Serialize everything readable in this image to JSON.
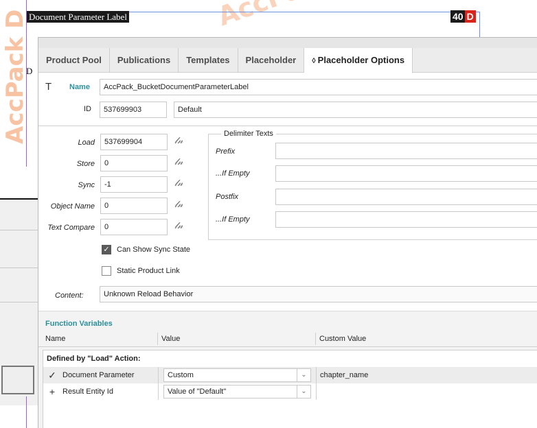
{
  "document": {
    "label": "Document Parameter Label",
    "page_number": "40",
    "page_letter": "D",
    "fragment_letter": "D",
    "watermark_text": "AccPack D",
    "watermark_top": "AccPa"
  },
  "tabs": [
    {
      "label": "Product Pool",
      "active": false
    },
    {
      "label": "Publications",
      "active": false
    },
    {
      "label": "Templates",
      "active": false
    },
    {
      "label": "Placeholder",
      "active": false
    },
    {
      "label": "Placeholder Options",
      "active": true,
      "icon": "chevron-up-down-icon",
      "icon_glyph": "◊"
    }
  ],
  "header": {
    "name_label": "Name",
    "name_value": "AccPack_BucketDocumentParameterLabel",
    "id_label": "ID",
    "id_value": "537699903",
    "id_extra": "Default"
  },
  "parameters": [
    {
      "label": "Load",
      "value": "537699904"
    },
    {
      "label": "Store",
      "value": "0"
    },
    {
      "label": "Sync",
      "value": "-1"
    },
    {
      "label": "Object Name",
      "value": "0"
    },
    {
      "label": "Text Compare",
      "value": "0"
    }
  ],
  "delimiter": {
    "title": "Delimiter Texts",
    "fields": [
      {
        "label": "Prefix",
        "value": ""
      },
      {
        "label": "...If Empty",
        "value": ""
      },
      {
        "label": "Postfix",
        "value": ""
      },
      {
        "label": "...If Empty",
        "value": ""
      }
    ]
  },
  "checkboxes": [
    {
      "label": "Can Show Sync State",
      "checked": true
    },
    {
      "label": "Static Product Link",
      "checked": false
    }
  ],
  "content": {
    "label": "Content:",
    "value": "Unknown Reload Behavior"
  },
  "function_variables": {
    "title": "Function Variables",
    "columns": [
      "Name",
      "Value",
      "Custom Value"
    ],
    "group_label": "Defined by \"Load\" Action:",
    "rows": [
      {
        "icon": "checkmark-icon",
        "glyph": "✓",
        "name": "Document Parameter",
        "value": "Custom",
        "custom_value": "chapter_name"
      },
      {
        "icon": "plus-icon",
        "glyph": "+",
        "name": "Result Entity Id",
        "value": "Value of \"Default\"",
        "custom_value": ""
      }
    ]
  },
  "colors": {
    "accent": "#2b8f9b",
    "badge_red": "#d9241c",
    "watermark": "#f5b084"
  }
}
